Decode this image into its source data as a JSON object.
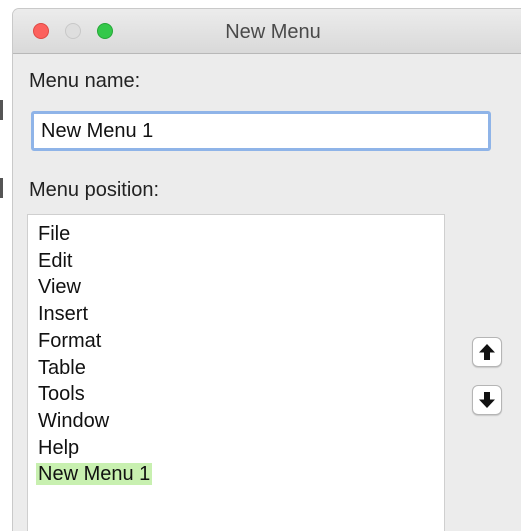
{
  "window": {
    "title": "New Menu"
  },
  "menu_name": {
    "label": "Menu name:",
    "value": "New Menu 1"
  },
  "menu_position": {
    "label": "Menu position:",
    "items": [
      "File",
      "Edit",
      "View",
      "Insert",
      "Format",
      "Table",
      "Tools",
      "Window",
      "Help",
      "New Menu 1"
    ],
    "selected": "New Menu 1"
  },
  "buttons": {
    "move_up_icon": "arrow-up-icon",
    "move_down_icon": "arrow-down-icon"
  },
  "colors": {
    "selection_highlight": "#c8f0b0",
    "input_focus_ring": "#8fb4e8",
    "close": "#fc615d",
    "minimize": "#dedede",
    "maximize": "#34c84a"
  }
}
